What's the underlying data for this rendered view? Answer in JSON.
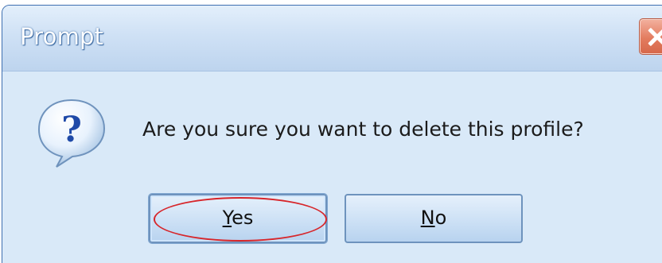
{
  "window": {
    "title": "Prompt",
    "close_icon": "close-icon"
  },
  "dialog": {
    "icon": "question-icon",
    "message": "Are you sure you want to delete this profile?"
  },
  "buttons": {
    "yes": {
      "mnemonic": "Y",
      "rest": "es"
    },
    "no": {
      "mnemonic": "N",
      "rest": "o"
    }
  },
  "annotation": {
    "type": "red-ellipse",
    "color": "#d7262b",
    "target": "yes"
  },
  "colors": {
    "title_text": "#ffffff",
    "dialog_bg": "#d9e9f8",
    "close_button": "#e37c5f",
    "button_border": "#6e93bd"
  }
}
